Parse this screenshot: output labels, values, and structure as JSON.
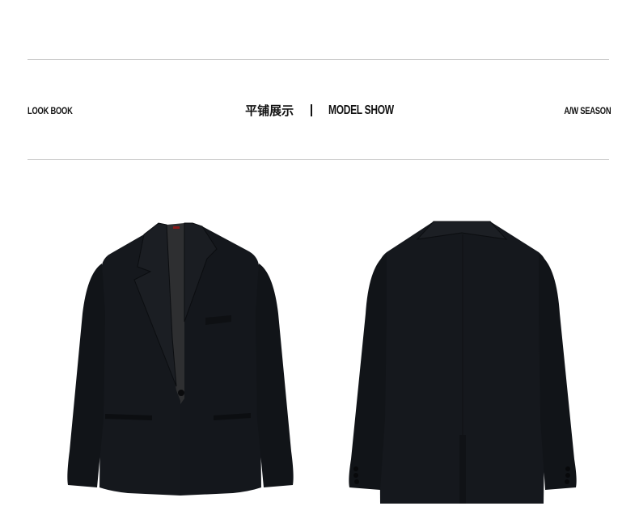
{
  "header": {
    "left_label": "LOOK BOOK",
    "title_cn": "平铺展示",
    "title_en": "MODEL SHOW",
    "right_label": "A/W SEASON"
  },
  "images": {
    "front": {
      "icon": "blazer-front-icon"
    },
    "back": {
      "icon": "blazer-back-icon"
    }
  },
  "colors": {
    "background": "#ffffff",
    "rule": "#c8c8c8",
    "text": "#111111",
    "jacket": "#15181d",
    "lining": "#2e2f31",
    "label_tag": "#8b1a1a"
  }
}
